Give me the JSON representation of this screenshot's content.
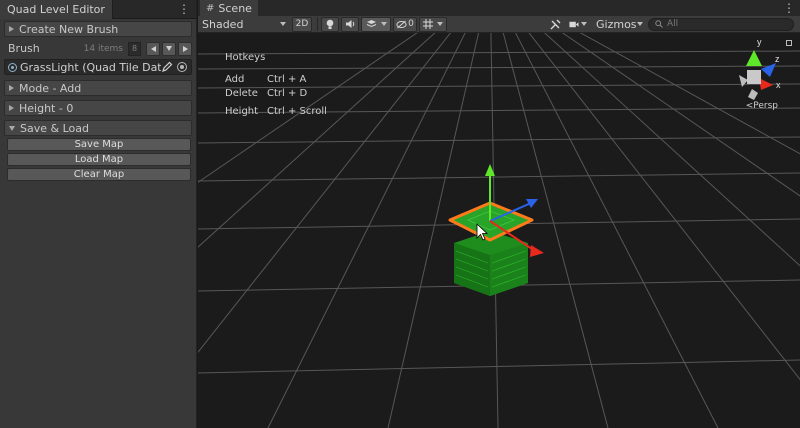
{
  "left_panel": {
    "tab_title": "Quad Level Editor",
    "create_brush_label": "Create New Brush",
    "brush_label": "Brush",
    "brush_count": "14 items",
    "brush_index": "8",
    "brush_value": "GrassLight (Quad Tile Data)",
    "mode_label": "Mode - Add",
    "height_label": "Height - 0",
    "save_load_label": "Save & Load",
    "save_button": "Save Map",
    "load_button": "Load Map",
    "clear_button": "Clear Map"
  },
  "scene": {
    "tab_title": "Scene",
    "shading_mode": "Shaded",
    "mode_2d": "2D",
    "hidden_count": "0",
    "gizmos_label": "Gizmos",
    "search_placeholder": "All",
    "projection_label": "Persp",
    "axis_labels": {
      "x": "x",
      "y": "y",
      "z": "z"
    },
    "hotkeys": {
      "title": "Hotkeys",
      "rows": [
        {
          "action": "Add",
          "keys": "Ctrl + A"
        },
        {
          "action": "Delete",
          "keys": "Ctrl + D"
        },
        {
          "action": "Height",
          "keys": "Ctrl + Scroll"
        }
      ]
    }
  },
  "colors": {
    "panel_bg": "#383838",
    "scene_bg": "#1b1b1b",
    "grid_line": "#6a6a6a",
    "tile_green": "#22a422",
    "selection_outline": "#ff7a1a",
    "axis_x": "#e8291d",
    "axis_y": "#5fe82a",
    "axis_z": "#2a63e8"
  }
}
